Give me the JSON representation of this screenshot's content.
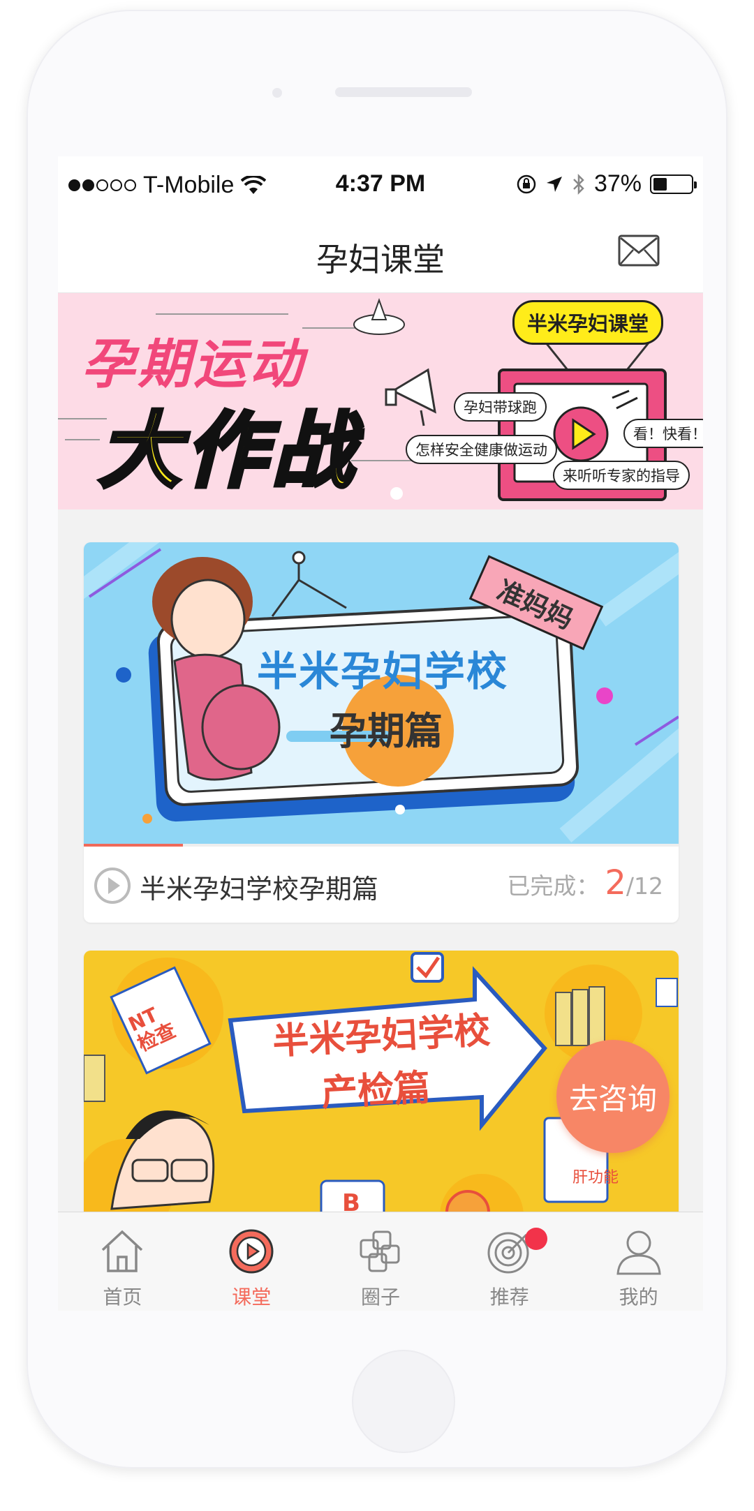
{
  "status_bar": {
    "carrier": "T-Mobile",
    "time": "4:37 PM",
    "battery_percent": "37%",
    "battery_level": 0.37,
    "signal_bars_filled": 2,
    "signal_bars_total": 5
  },
  "header": {
    "title": "孕妇课堂",
    "mail_icon": "mail-icon"
  },
  "banner": {
    "title_line1": "孕期运动",
    "title_line2": "大作战",
    "badge": "半米孕妇课堂",
    "tag1": "孕妇带球跑",
    "tag2": "怎样安全健康做运动",
    "tag3": "看！快看！",
    "tag4": "来听听专家的指导",
    "page_dots": 1,
    "active_dot": 0
  },
  "courses": [
    {
      "cover_ribbon": "准妈妈",
      "cover_title": "半米孕妇学校",
      "cover_subtitle": "孕期篇",
      "title": "半米孕妇学校孕期篇",
      "completed_label": "已完成：",
      "completed": "2",
      "total": "/12",
      "progress": 0.1667
    },
    {
      "cover_title": "半米孕妇学校",
      "cover_subtitle": "产检篇",
      "cover_tag1": "NT",
      "cover_tag2": "检查",
      "cover_tag3": "肝功能",
      "cover_tag4": "B"
    }
  ],
  "consult_button": "去咨询",
  "tabs": [
    {
      "label": "首页",
      "icon": "home-icon",
      "active": false
    },
    {
      "label": "课堂",
      "icon": "play-circle-icon",
      "active": true
    },
    {
      "label": "圈子",
      "icon": "circles-icon",
      "active": false
    },
    {
      "label": "推荐",
      "icon": "target-icon",
      "active": false,
      "badge": true
    },
    {
      "label": "我的",
      "icon": "user-icon",
      "active": false
    }
  ],
  "colors": {
    "accent": "#f46b5c",
    "banner_bg": "#fddbe6",
    "card1_bg": "#8fd6f5",
    "card2_bg": "#f6c828",
    "consult_bg": "#f78666",
    "badge_red": "#f2334a"
  }
}
